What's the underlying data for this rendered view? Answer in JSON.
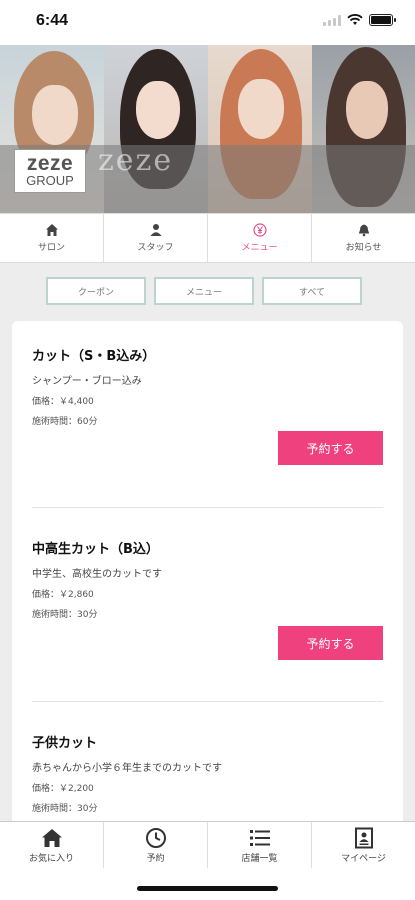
{
  "status": {
    "time": "6:44"
  },
  "brand": {
    "logo_main": "zeze",
    "logo_sub": "GROUP"
  },
  "top_nav": [
    {
      "label": "サロン",
      "icon": "home-icon"
    },
    {
      "label": "スタッフ",
      "icon": "person-icon"
    },
    {
      "label": "メニュー",
      "icon": "yen-icon",
      "active": true
    },
    {
      "label": "お知らせ",
      "icon": "bell-icon"
    }
  ],
  "filters": [
    "クーポン",
    "メニュー",
    "すべて"
  ],
  "menu_items": [
    {
      "name": "カット（S・B込み）",
      "desc": "シャンプー・ブロー込み",
      "price": "価格：￥4,400",
      "time": "施術時間：60分",
      "button": "予約する"
    },
    {
      "name": "中高生カット（B込）",
      "desc": "中学生、高校生のカットです",
      "price": "価格：￥2,860",
      "time": "施術時間：30分",
      "button": "予約する"
    },
    {
      "name": "子供カット",
      "desc": "赤ちゃんから小学６年生までのカットです",
      "price": "価格：￥2,200",
      "time": "施術時間：30分"
    }
  ],
  "bottom_nav": [
    {
      "label": "お気に入り",
      "icon": "home-icon"
    },
    {
      "label": "予約",
      "icon": "clock-icon"
    },
    {
      "label": "店舗一覧",
      "icon": "list-icon"
    },
    {
      "label": "マイページ",
      "icon": "id-card-icon"
    }
  ],
  "colors": {
    "accent": "#f0417f",
    "filter_border": "#bcd4cf",
    "background": "#ededed"
  }
}
